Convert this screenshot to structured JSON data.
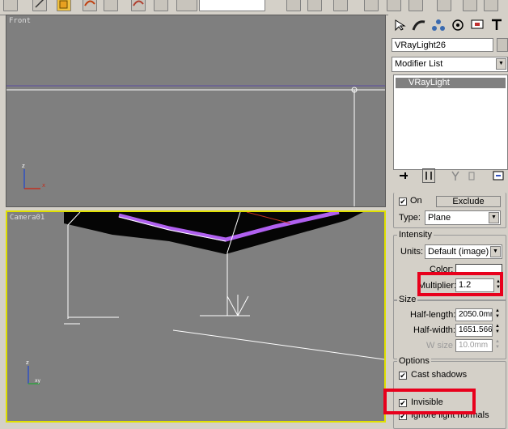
{
  "front_viewport": {
    "label": "Front"
  },
  "camera_viewport": {
    "label": "Camera01"
  },
  "panel": {
    "object_name": "VRayLight26",
    "modifier_list": "Modifier List",
    "stack_item": "VRayLight"
  },
  "parameters": {
    "on_label": "On",
    "exclude_label": "Exclude",
    "type_label": "Type:",
    "type_value": "Plane"
  },
  "intensity": {
    "title": "Intensity",
    "units_label": "Units:",
    "units_value": "Default (image)",
    "color_label": "Color:",
    "multiplier_label": "Multiplier:",
    "multiplier_value": "1.2"
  },
  "size": {
    "title": "Size",
    "half_length_label": "Half-length:",
    "half_length_value": "2050.0mm",
    "half_width_label": "Half-width:",
    "half_width_value": "1651.566",
    "w_size_label": "W size",
    "w_size_value": "10.0mm"
  },
  "options": {
    "title": "Options",
    "cast_shadows_label": "Cast shadows",
    "invisible_label": "Invisible",
    "ignore_normals_label": "Ignore light normals"
  },
  "colors": {
    "highlight": "#e8001c",
    "light_color": "#ffffff",
    "active_viewport_border": "#e0e000",
    "light_edge": "#a050f0"
  }
}
